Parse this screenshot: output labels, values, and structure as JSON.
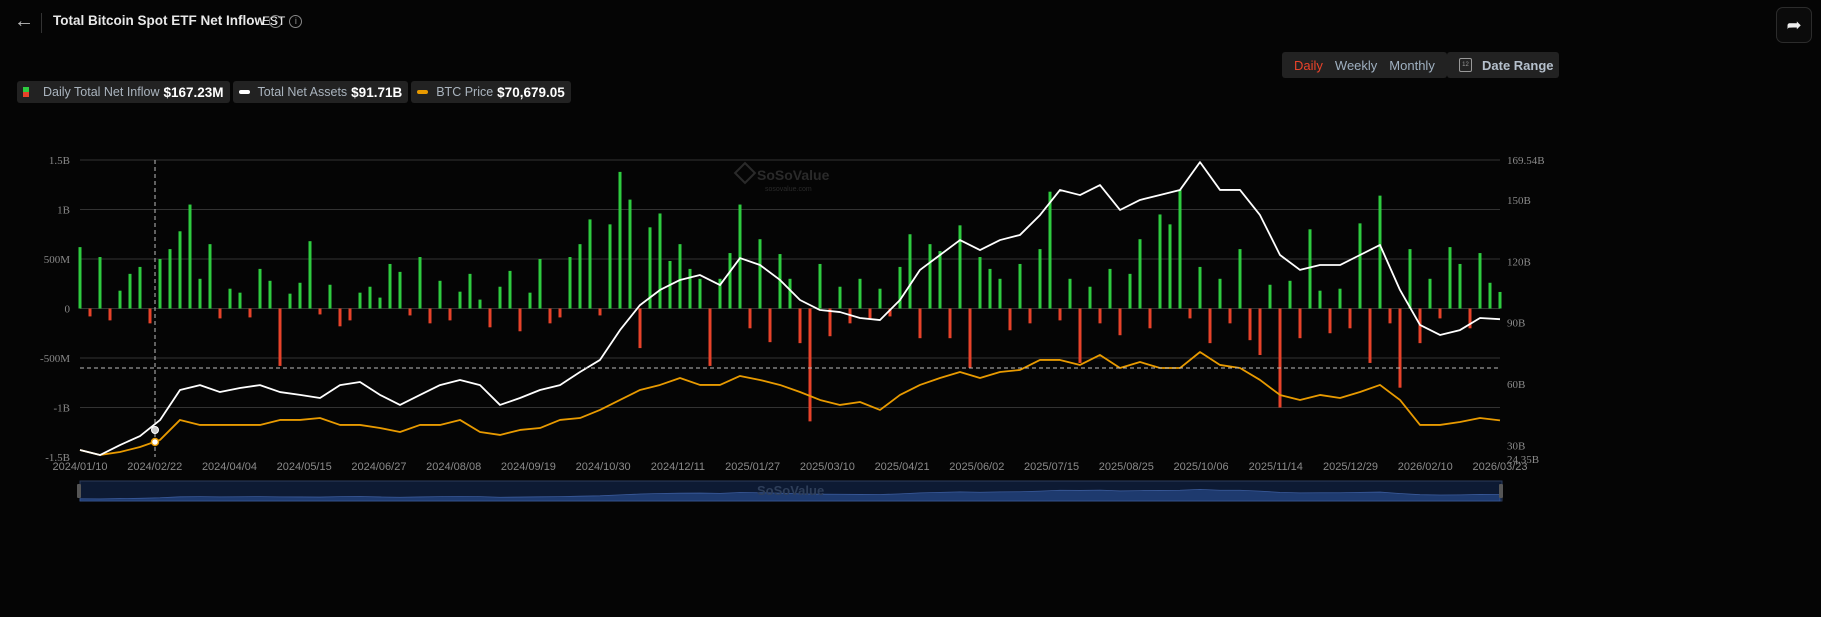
{
  "header": {
    "back_icon": "arrow-left-icon",
    "title": "Total Bitcoin Spot ETF Net Inflow",
    "timezone": "EST",
    "info_icon": "i",
    "share_icon": "share-icon"
  },
  "controls": {
    "periods": [
      "Daily",
      "Weekly",
      "Monthly"
    ],
    "active_period": "Daily",
    "date_range_label": "Date Range",
    "calendar_icon_text": "12"
  },
  "legend": [
    {
      "label": "Daily Total Net Inflow",
      "value": "$167.23M"
    },
    {
      "label": "Total Net Assets",
      "value": "$91.71B"
    },
    {
      "label": "BTC Price",
      "value": "$70,679.05"
    }
  ],
  "colors": {
    "positive": "#2ecc40",
    "negative": "#e8432a",
    "net_assets": "#ffffff",
    "btc_price": "#e89a00",
    "grid": "#333333",
    "navigator": "#1e3a6e"
  },
  "watermark": {
    "name": "SoSoValue",
    "url_text": "sosovalue.com"
  },
  "chart_data": {
    "type": "bar+line",
    "title": "Total Bitcoin Spot ETF Net Inflow",
    "x_start": "2024/01/10",
    "x_end": "2026/03/23",
    "x_tick_labels": [
      "2024/01/10",
      "2024/02/22",
      "2024/04/04",
      "2024/05/15",
      "2024/06/27",
      "2024/08/08",
      "2024/09/19",
      "2024/10/30",
      "2024/12/11",
      "2025/01/27",
      "2025/03/10",
      "2025/04/21",
      "2025/06/02",
      "2025/07/15",
      "2025/08/25",
      "2025/10/06",
      "2025/11/14",
      "2025/12/29",
      "2026/02/10",
      "2026/03/23"
    ],
    "left_axis": {
      "unit": "USD",
      "ylim": [
        -1.5,
        1.5
      ],
      "tick_labels": [
        "1.5B",
        "1B",
        "500M",
        "0",
        "-500M",
        "-1B",
        "-1.5B"
      ],
      "tick_values_billion": [
        1.5,
        1,
        0.5,
        0,
        -0.5,
        -1,
        -1.5
      ]
    },
    "right_axis": {
      "ylim": [
        24.35,
        169.54
      ],
      "tick_labels": [
        "169.54B",
        "150B",
        "120B",
        "90B",
        "60B",
        "30B",
        "24.35B"
      ],
      "tick_values_billion": [
        169.54,
        150,
        120,
        90,
        60,
        30,
        24.35
      ]
    },
    "crosshair": {
      "date": "2024/02/22",
      "value_label": "24.35B"
    },
    "series": [
      {
        "name": "Daily Total Net Inflow",
        "unit": "M USD",
        "type": "bar",
        "values": [
          620,
          -80,
          520,
          -120,
          180,
          350,
          420,
          -150,
          500,
          600,
          780,
          1050,
          300,
          650,
          -100,
          200,
          160,
          -90,
          400,
          280,
          -580,
          150,
          260,
          680,
          -60,
          240,
          -180,
          -120,
          160,
          220,
          110,
          450,
          370,
          -70,
          520,
          -150,
          280,
          -120,
          170,
          350,
          90,
          -190,
          220,
          380,
          -230,
          160,
          500,
          -150,
          -90,
          520,
          650,
          900,
          -70,
          850,
          1380,
          1100,
          -400,
          820,
          960,
          480,
          650,
          400,
          300,
          -580,
          300,
          560,
          1050,
          -200,
          700,
          -340,
          550,
          300,
          -350,
          -1140,
          450,
          -280,
          220,
          -150,
          300,
          -100,
          200,
          -80,
          420,
          750,
          -300,
          650,
          580,
          -300,
          840,
          -600,
          520,
          400,
          300,
          -220,
          450,
          -150,
          600,
          1180,
          -120,
          300,
          -550,
          220,
          -150,
          400,
          -270,
          350,
          700,
          -200,
          950,
          850,
          1200,
          -100,
          420,
          -350,
          300,
          -150,
          600,
          -320,
          -470,
          240,
          -1000,
          280,
          -300,
          800,
          180,
          -250,
          200,
          -200,
          860,
          -550,
          1140,
          -150,
          -800,
          600,
          -350,
          300,
          -100,
          620,
          450,
          -200,
          560,
          260,
          167.23
        ]
      },
      {
        "name": "Total Net Assets",
        "unit": "B USD",
        "type": "line",
        "values": [
          27.8,
          25.3,
          30.2,
          34.6,
          42.4,
          57.1,
          59.5,
          56.1,
          58.1,
          59.5,
          56.1,
          54.7,
          53.2,
          59.5,
          61.0,
          54.7,
          49.8,
          54.7,
          59.5,
          62.0,
          59.5,
          49.8,
          53.2,
          57.1,
          59.5,
          65.9,
          71.8,
          86.4,
          98.6,
          106.0,
          110.9,
          113.3,
          108.4,
          121.6,
          118.2,
          110.9,
          101.1,
          96.2,
          95.2,
          92.3,
          91.3,
          101.1,
          115.8,
          123.1,
          130.4,
          125.5,
          130.4,
          132.9,
          142.6,
          154.9,
          152.4,
          157.3,
          145.1,
          150.0,
          152.4,
          154.9,
          168.5,
          154.9,
          154.9,
          142.6,
          123.1,
          115.8,
          118.2,
          118.2,
          123.1,
          128.0,
          106.0,
          88.9,
          84.0,
          86.4,
          92.3,
          91.71
        ]
      },
      {
        "name": "BTC Price",
        "unit": "K USD",
        "type": "line",
        "values": [
          47.6,
          43.7,
          46.0,
          49.9,
          55.4,
          71.0,
          67.1,
          67.1,
          67.1,
          67.1,
          71.0,
          71.0,
          72.5,
          67.1,
          67.1,
          64.7,
          61.6,
          67.1,
          67.1,
          71.0,
          61.6,
          59.3,
          63.2,
          64.7,
          71.0,
          72.5,
          78.8,
          86.6,
          94.4,
          98.3,
          103.7,
          98.3,
          98.3,
          105.3,
          102.2,
          98.3,
          92.8,
          86.6,
          82.7,
          85.0,
          78.8,
          90.5,
          98.3,
          103.7,
          108.4,
          103.7,
          108.4,
          110.0,
          117.8,
          117.8,
          113.9,
          121.7,
          111.5,
          116.2,
          111.5,
          111.5,
          124.0,
          113.9,
          111.5,
          102.2,
          90.5,
          86.6,
          90.5,
          88.1,
          92.8,
          98.3,
          86.6,
          67.1,
          67.1,
          69.4,
          72.5,
          70.68
        ]
      }
    ],
    "grid": true,
    "legend_position": "top-left"
  }
}
